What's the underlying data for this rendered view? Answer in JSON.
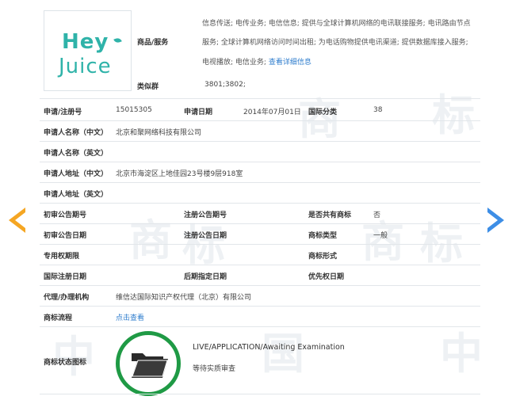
{
  "logo": {
    "line1": "Hey",
    "line2": "Juice"
  },
  "goods_services": {
    "label": "商品/服务",
    "lines": [
      "信息传送; 电传业务; 电信信息; 提供与全球计算机网络的电讯联接服务; 电讯路由节点",
      "服务; 全球计算机网络访问时间出租; 为电话购物提供电讯渠道; 提供数据库接入服务;",
      "电视播放; 电信业务;"
    ],
    "detail_link": "查看详细信息"
  },
  "similar_group": {
    "label": "类似群",
    "value": "3801;3802;"
  },
  "rows": {
    "reg_no_label": "申请/注册号",
    "reg_no": "15015305",
    "apply_date_label": "申请日期",
    "apply_date": "2014年07月01日",
    "intl_class_label": "国际分类",
    "intl_class": "38",
    "applicant_cn_label": "申请人名称（中文）",
    "applicant_cn": "北京和聚网络科技有限公司",
    "applicant_en_label": "申请人名称（英文）",
    "address_cn_label": "申请人地址（中文）",
    "address_cn": "北京市海淀区上地佳园23号楼9层918室",
    "address_en_label": "申请人地址（英文）",
    "prelim_pub_no_label": "初审公告期号",
    "reg_pub_no_label": "注册公告期号",
    "shared_label": "是否共有商标",
    "shared": "否",
    "prelim_pub_date_label": "初审公告日期",
    "reg_pub_date_label": "注册公告日期",
    "mark_type_label": "商标类型",
    "mark_type": "一般",
    "exclusive_period_label": "专用权期限",
    "mark_form_label": "商标形式",
    "intl_reg_date_label": "国际注册日期",
    "later_date_label": "后期指定日期",
    "priority_date_label": "优先权日期",
    "agent_label": "代理/办理机构",
    "agent": "维信达国际知识产权代理（北京）有限公司",
    "flow_label": "商标流程",
    "flow_link": "点击查看",
    "status_icon_label": "商标状态图标"
  },
  "status": {
    "en": "LIVE/APPLICATION/Awaiting Examination",
    "cn": "等待实质审查"
  },
  "watermark": {
    "chars": [
      "商",
      "标",
      "中",
      "国"
    ]
  },
  "icons": {
    "prev": "arrow-left-icon",
    "next": "arrow-right-icon",
    "status": "folder-icon"
  },
  "colors": {
    "logo": "#2fb3a9",
    "link": "#2d7ccd",
    "prev_arrow": "#f5a623",
    "next_arrow": "#3d8ee6",
    "status_ring": "#1f9a45"
  }
}
